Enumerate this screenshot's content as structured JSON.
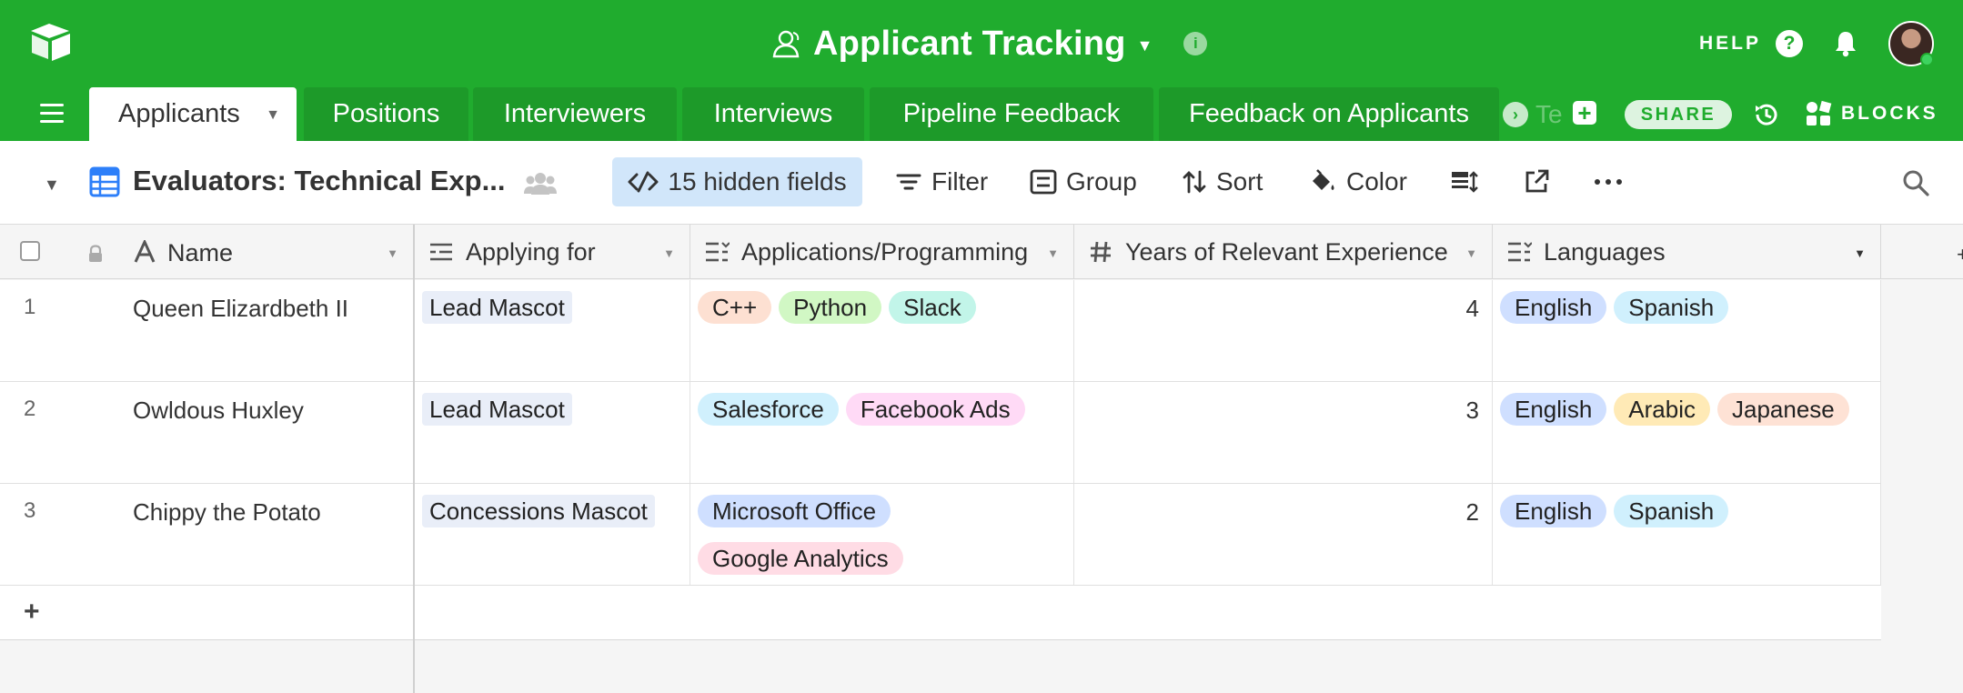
{
  "header": {
    "app_title": "Applicant Tracking",
    "help_label": "HELP",
    "share_label": "SHARE",
    "blocks_label": "BLOCKS",
    "overflow_tab_partial": "Te"
  },
  "tabs": [
    {
      "label": "Applicants",
      "active": true
    },
    {
      "label": "Positions",
      "active": false
    },
    {
      "label": "Interviewers",
      "active": false
    },
    {
      "label": "Interviews",
      "active": false
    },
    {
      "label": "Pipeline Feedback",
      "active": false
    },
    {
      "label": "Feedback on Applicants",
      "active": false
    }
  ],
  "view": {
    "name": "Evaluators: Technical Exp...",
    "hidden_fields_label": "15 hidden fields",
    "filter_label": "Filter",
    "group_label": "Group",
    "sort_label": "Sort",
    "color_label": "Color"
  },
  "columns": [
    {
      "label": "Name",
      "icon": "text-field-icon"
    },
    {
      "label": "Applying for",
      "icon": "link-field-icon"
    },
    {
      "label": "Applications/Programming",
      "icon": "multi-select-icon"
    },
    {
      "label": "Years of Relevant Experience",
      "icon": "number-field-icon"
    },
    {
      "label": "Languages",
      "icon": "multi-select-icon"
    }
  ],
  "rows": [
    {
      "num": "1",
      "name": "Queen Elizardbeth II",
      "applying_for": "Lead Mascot",
      "apps": [
        {
          "label": "C++",
          "color": "#fde0d2"
        },
        {
          "label": "Python",
          "color": "#d1f7c4"
        },
        {
          "label": "Slack",
          "color": "#c2f5e9"
        }
      ],
      "years": "4",
      "languages": [
        {
          "label": "English",
          "color": "#cfdfff"
        },
        {
          "label": "Spanish",
          "color": "#d0f0fd"
        }
      ]
    },
    {
      "num": "2",
      "name": "Owldous Huxley",
      "applying_for": "Lead Mascot",
      "apps": [
        {
          "label": "Salesforce",
          "color": "#d0f0fd"
        },
        {
          "label": "Facebook Ads",
          "color": "#ffdaf6"
        }
      ],
      "years": "3",
      "languages": [
        {
          "label": "English",
          "color": "#cfdfff"
        },
        {
          "label": "Arabic",
          "color": "#ffeab6"
        },
        {
          "label": "Japanese",
          "color": "#fee2d5"
        }
      ]
    },
    {
      "num": "3",
      "name": "Chippy the Potato",
      "applying_for": "Concessions Mascot",
      "apps": [
        {
          "label": "Microsoft Office",
          "color": "#cfdfff"
        },
        {
          "label": "Google Analytics",
          "color": "#ffdce5"
        }
      ],
      "years": "2",
      "languages": [
        {
          "label": "English",
          "color": "#cfdfff"
        },
        {
          "label": "Spanish",
          "color": "#d0f0fd"
        }
      ]
    }
  ],
  "colors": {
    "brand_green": "#20ac2e",
    "tab_green": "#1d9a29",
    "hidden_fields_bg": "#d1e6fa",
    "view_icon_blue": "#2d7ff9"
  }
}
